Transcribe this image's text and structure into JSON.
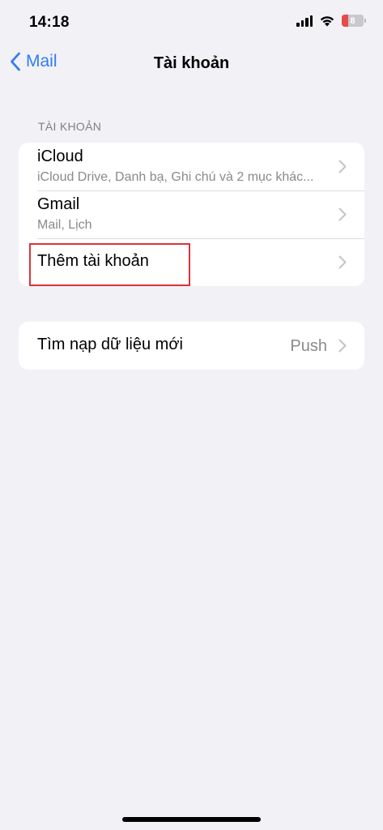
{
  "status_bar": {
    "time": "14:18",
    "battery_level": "8",
    "icons": [
      "cellular-signal-icon",
      "wifi-icon",
      "battery-icon"
    ],
    "battery_color": "#e84a4a"
  },
  "nav": {
    "back_label": "Mail",
    "title": "Tài khoản",
    "accent_color": "#2f7cf6"
  },
  "accounts_section": {
    "header": "TÀI KHOẢN",
    "items": [
      {
        "title": "iCloud",
        "subtitle": "iCloud Drive, Danh bạ, Ghi chú và 2 mục khác..."
      },
      {
        "title": "Gmail",
        "subtitle": "Mail, Lịch"
      },
      {
        "title": "Thêm tài khoản"
      }
    ]
  },
  "fetch_section": {
    "title": "Tìm nạp dữ liệu mới",
    "value": "Push"
  },
  "annotation_color": "#d9333a"
}
